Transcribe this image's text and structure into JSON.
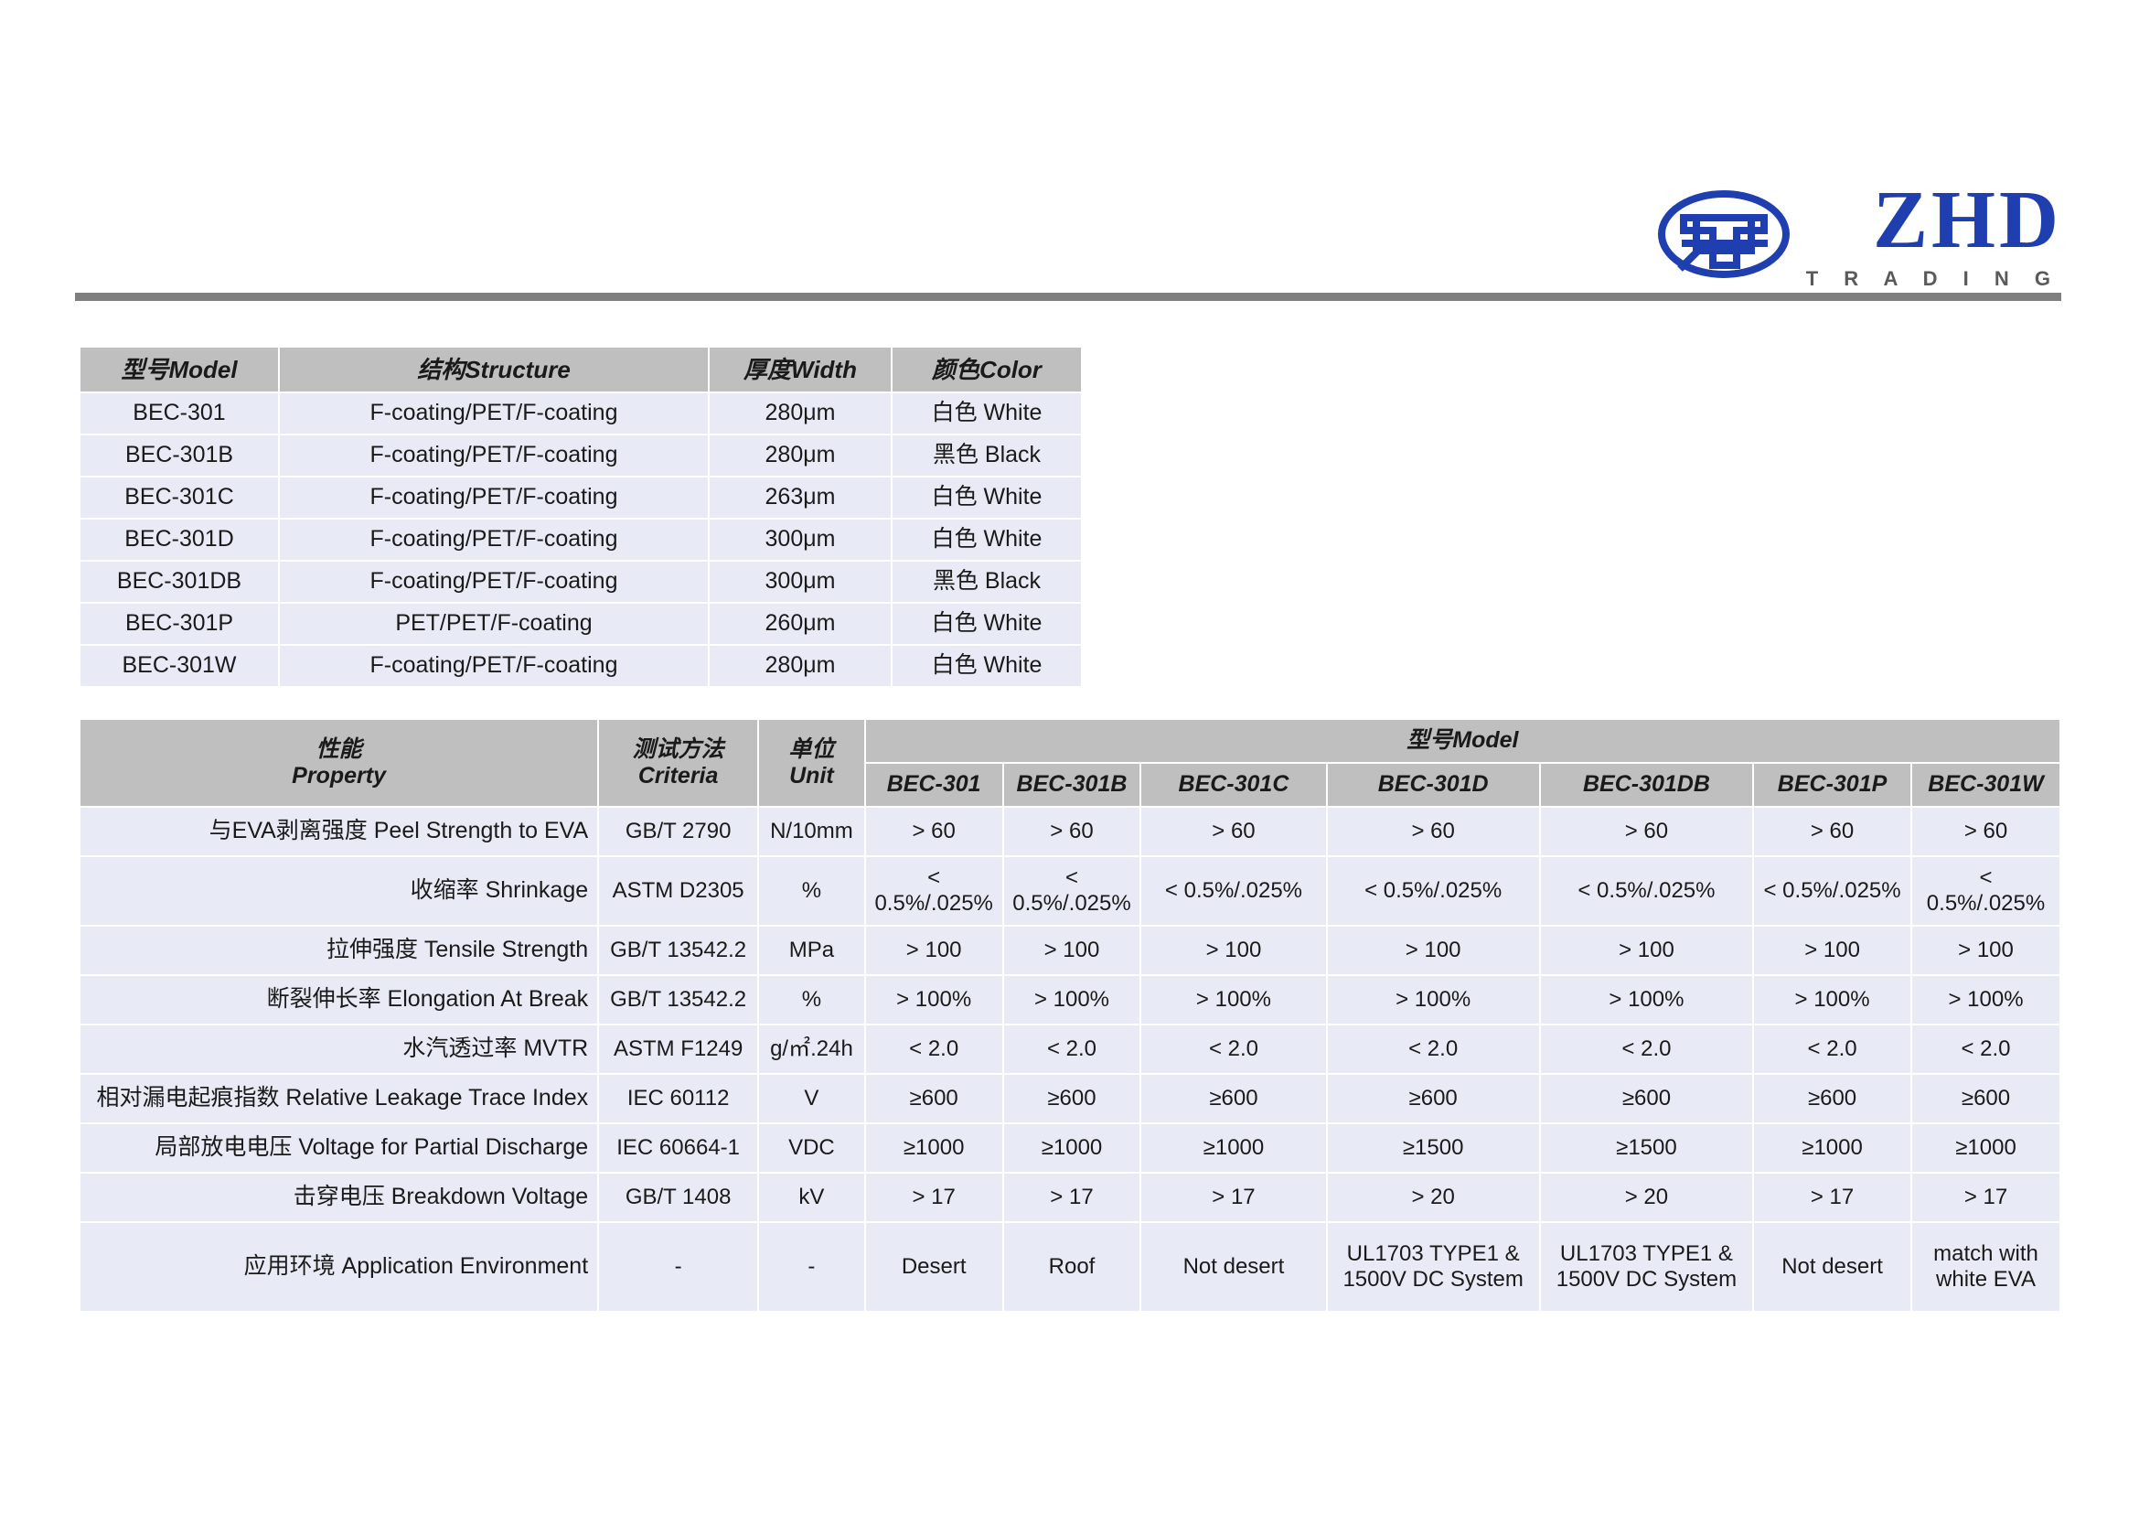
{
  "header": {
    "logo_mark_name": "zhd-ellipse-monogram",
    "logo_word": "ZHD",
    "logo_sub": "T R A D I N G",
    "brand_color": "#1f3fb0",
    "rule_color": "#7f7f7f"
  },
  "table1": {
    "columns": [
      {
        "cn": "型号",
        "en": "Model"
      },
      {
        "cn": "结构",
        "en": "Structure"
      },
      {
        "cn": "厚度",
        "en": "Width"
      },
      {
        "cn": "颜色",
        "en": "Color"
      }
    ],
    "headers": [
      "型号Model",
      "结构Structure",
      "厚度Width",
      "颜色Color"
    ],
    "rows": [
      {
        "model": "BEC-301",
        "structure": "F-coating/PET/F-coating",
        "width": "280μm",
        "color": "白色 White"
      },
      {
        "model": "BEC-301B",
        "structure": "F-coating/PET/F-coating",
        "width": "280μm",
        "color": "黑色 Black"
      },
      {
        "model": "BEC-301C",
        "structure": "F-coating/PET/F-coating",
        "width": "263μm",
        "color": "白色 White"
      },
      {
        "model": "BEC-301D",
        "structure": "F-coating/PET/F-coating",
        "width": "300μm",
        "color": "白色 White"
      },
      {
        "model": "BEC-301DB",
        "structure": "F-coating/PET/F-coating",
        "width": "300μm",
        "color": "黑色 Black"
      },
      {
        "model": "BEC-301P",
        "structure": "PET/PET/F-coating",
        "width": "260μm",
        "color": "白色 White"
      },
      {
        "model": "BEC-301W",
        "structure": "F-coating/PET/F-coating",
        "width": "280μm",
        "color": "白色 White"
      }
    ]
  },
  "table2": {
    "header": {
      "property_cn": "性能",
      "property_en": "Property",
      "criteria_cn": "测试方法",
      "criteria_en": "Criteria",
      "unit_cn": "单位",
      "unit_en": "Unit",
      "model_group": "型号Model",
      "models": [
        "BEC-301",
        "BEC-301B",
        "BEC-301C",
        "BEC-301D",
        "BEC-301DB",
        "BEC-301P",
        "BEC-301W"
      ]
    },
    "rows": [
      {
        "property": "与EVA剥离强度 Peel Strength to EVA",
        "criteria": "GB/T 2790",
        "unit": "N/10mm",
        "values": [
          "> 60",
          "> 60",
          "> 60",
          "> 60",
          "> 60",
          "> 60",
          "> 60"
        ]
      },
      {
        "property": "收缩率 Shrinkage",
        "criteria": "ASTM D2305",
        "unit": "%",
        "values": [
          "< 0.5%/.025%",
          "< 0.5%/.025%",
          "< 0.5%/.025%",
          "< 0.5%/.025%",
          "< 0.5%/.025%",
          "< 0.5%/.025%",
          "< 0.5%/.025%"
        ]
      },
      {
        "property": "拉伸强度 Tensile Strength",
        "criteria": "GB/T 13542.2",
        "unit": "MPa",
        "values": [
          "> 100",
          "> 100",
          "> 100",
          "> 100",
          "> 100",
          "> 100",
          "> 100"
        ]
      },
      {
        "property": "断裂伸长率 Elongation At Break",
        "criteria": "GB/T 13542.2",
        "unit": "%",
        "values": [
          "> 100%",
          "> 100%",
          "> 100%",
          "> 100%",
          "> 100%",
          "> 100%",
          "> 100%"
        ]
      },
      {
        "property": "水汽透过率 MVTR",
        "criteria": "ASTM F1249",
        "unit": "g/㎡.24h",
        "values": [
          "< 2.0",
          "< 2.0",
          "< 2.0",
          "< 2.0",
          "< 2.0",
          "< 2.0",
          "< 2.0"
        ]
      },
      {
        "property": "相对漏电起痕指数 Relative Leakage Trace Index",
        "criteria": "IEC 60112",
        "unit": "V",
        "values": [
          "≥600",
          "≥600",
          "≥600",
          "≥600",
          "≥600",
          "≥600",
          "≥600"
        ]
      },
      {
        "property": "局部放电电压 Voltage for Partial Discharge",
        "criteria": "IEC 60664-1",
        "unit": "VDC",
        "values": [
          "≥1000",
          "≥1000",
          "≥1000",
          "≥1500",
          "≥1500",
          "≥1000",
          "≥1000"
        ]
      },
      {
        "property": "击穿电压 Breakdown Voltage",
        "criteria": "GB/T 1408",
        "unit": "kV",
        "values": [
          "> 17",
          "> 17",
          "> 17",
          "> 20",
          "> 20",
          "> 17",
          "> 17"
        ]
      },
      {
        "property": "应用环境 Application Environment",
        "criteria": "-",
        "unit": "-",
        "values": [
          "Desert",
          "Roof",
          "Not desert",
          "UL1703 TYPE1 & 1500V DC System",
          "UL1703 TYPE1 & 1500V DC System",
          "Not desert",
          "match with white EVA"
        ]
      }
    ]
  }
}
